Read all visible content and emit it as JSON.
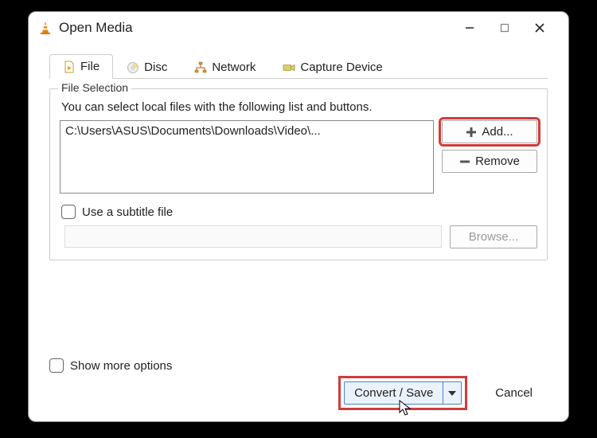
{
  "window": {
    "title": "Open Media"
  },
  "tabs": {
    "file": "File",
    "disc": "Disc",
    "network": "Network",
    "capture": "Capture Device"
  },
  "file_selection": {
    "legend": "File Selection",
    "hint": "You can select local files with the following list and buttons.",
    "files": [
      "C:\\Users\\ASUS\\Documents\\Downloads\\Video\\..."
    ],
    "add_label": "Add...",
    "remove_label": "Remove",
    "subtitle_checkbox_label": "Use a subtitle file",
    "browse_label": "Browse..."
  },
  "footer": {
    "more_options_label": "Show more options",
    "convert_label": "Convert / Save",
    "cancel_label": "Cancel"
  }
}
